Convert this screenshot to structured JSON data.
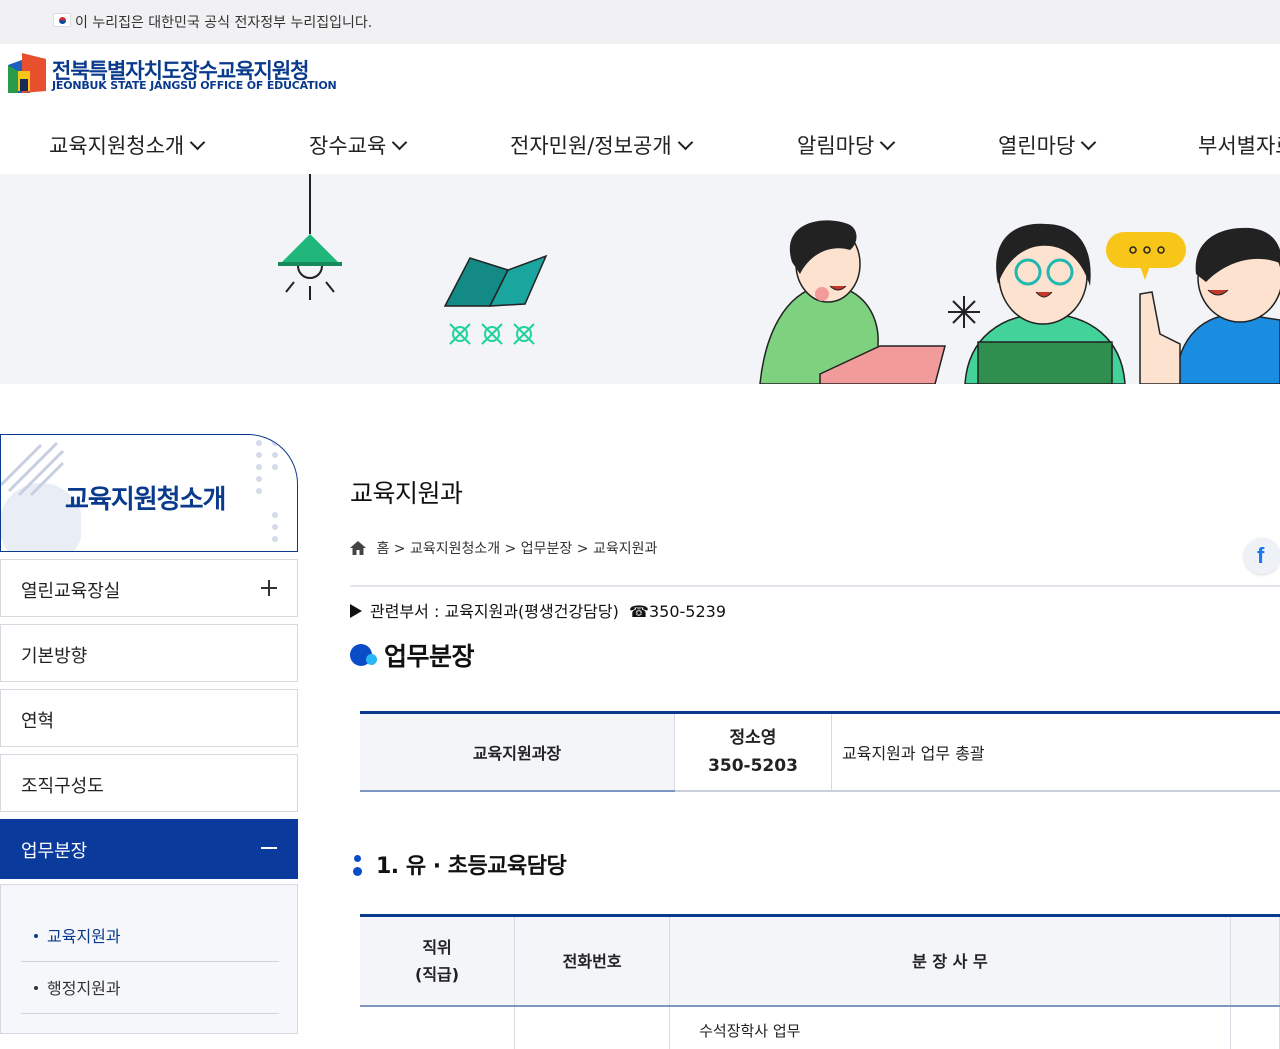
{
  "topbar": {
    "text": "이 누리집은 대한민국 공식 전자정부 누리집입니다."
  },
  "logo": {
    "ko": "전북특별자치도장수교육지원청",
    "en": "JEONBUK STATE JANGSU OFFICE OF EDUCATION"
  },
  "gnb": [
    "교육지원청소개",
    "장수교육",
    "전자민원/정보공개",
    "알림마당",
    "열린마당",
    "부서별자료"
  ],
  "sidebar": {
    "title": "교육지원청소개",
    "items": [
      {
        "label": "열린교육장실",
        "state": "plus"
      },
      {
        "label": "기본방향"
      },
      {
        "label": "연혁"
      },
      {
        "label": "조직구성도"
      },
      {
        "label": "업무분장",
        "state": "minus"
      }
    ],
    "sub": [
      "교육지원과",
      "행정지원과"
    ]
  },
  "content": {
    "title": "교육지원과",
    "breadcrumb": [
      "홈",
      "교육지원청소개",
      "업무분장",
      "교육지원과"
    ],
    "related": "관련부서 : 교육지원과(평생건강담당)",
    "phone": "☎350-5239",
    "section_title": "업무분장",
    "head_table": {
      "position": "교육지원과장",
      "name": "정소영",
      "tel": "350-5203",
      "duty": "교육지원과 업무 총괄"
    },
    "sub_title": "1. 유 · 초등교육담당",
    "duty_table": {
      "headers": [
        "직위\n(직급)",
        "전화번호",
        "분 장 사 무",
        ""
      ],
      "first_row_partial": "수석장학사 업무"
    }
  },
  "colors": {
    "brand": "#0a3a8c",
    "active": "#0a3a9c",
    "accent": "#0a4cc7"
  }
}
